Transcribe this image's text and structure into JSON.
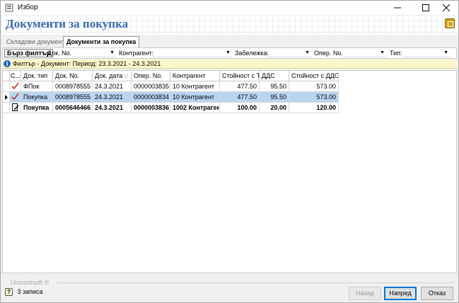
{
  "window": {
    "title": "Избор"
  },
  "header": {
    "page_title": "Документи за покупка"
  },
  "tabs": [
    {
      "label": "Складови документи",
      "active": false
    },
    {
      "label": "Документи за покупка",
      "active": true
    }
  ],
  "filterbar": {
    "quick_filter_label": "Бърз филтър",
    "fields": [
      {
        "label": "Док. No.",
        "value": ""
      },
      {
        "label": "Контрагент:",
        "value": ""
      },
      {
        "label": "Забележка:",
        "value": ""
      },
      {
        "label": "Опер. No.",
        "value": ""
      },
      {
        "label": "Тип:",
        "value": ""
      }
    ]
  },
  "info": {
    "text": "Филтър - Документ: Период: 23.3.2021 - 24.3.2021"
  },
  "grid": {
    "columns": [
      "С...",
      "Док. тип",
      "Док. No.",
      "Док. дата",
      "Опер. No.",
      "Контрагент",
      "Стойност с ТО",
      "ДДС",
      "Стойност с ДДС"
    ],
    "rows": [
      {
        "status": "check",
        "type": "ФПок",
        "doc_no": "0008978555",
        "date": "24.3.2021",
        "oper_no": "0000003835",
        "partner": "10 Контрагент",
        "value": "477.50",
        "vat": "95.50",
        "total": "573.00"
      },
      {
        "status": "check",
        "type": "Покупка",
        "doc_no": "0008978555",
        "date": "24.3.2021",
        "oper_no": "0000003834",
        "partner": "10 Контрагент",
        "value": "477.50",
        "vat": "95.50",
        "total": "573.00"
      },
      {
        "status": "edit",
        "type": "Покупка",
        "doc_no": "0005646466",
        "date": "24.3.2021",
        "oper_no": "0000003836",
        "partner": "1002 Контрагент",
        "value": "100.00",
        "vat": "20.00",
        "total": "120.00"
      }
    ]
  },
  "footer": {
    "brand": "Unicontsoft ®",
    "status": "3 записа",
    "back_label": "Назад",
    "next_label": "Напред",
    "cancel_label": "Отказ"
  },
  "colors": {
    "title": "#3a6aa8",
    "selection": "#b9d5f2",
    "info_bg": "#fbf7c9",
    "check": "#c0392b"
  }
}
